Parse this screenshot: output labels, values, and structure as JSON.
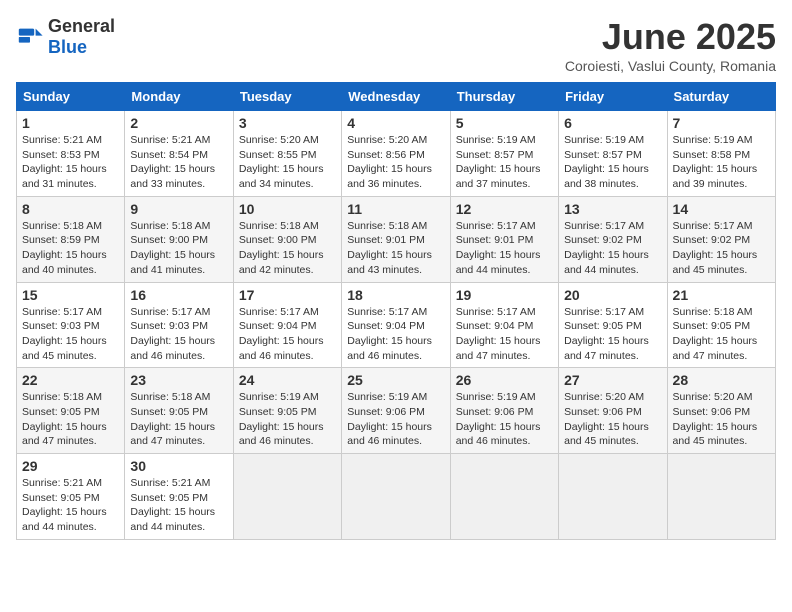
{
  "app": {
    "name_general": "General",
    "name_blue": "Blue"
  },
  "calendar": {
    "title": "June 2025",
    "subtitle": "Coroiesti, Vaslui County, Romania",
    "days_of_week": [
      "Sunday",
      "Monday",
      "Tuesday",
      "Wednesday",
      "Thursday",
      "Friday",
      "Saturday"
    ],
    "weeks": [
      [
        null,
        {
          "day": "2",
          "sunrise": "Sunrise: 5:21 AM",
          "sunset": "Sunset: 8:54 PM",
          "daylight": "Daylight: 15 hours and 33 minutes."
        },
        {
          "day": "3",
          "sunrise": "Sunrise: 5:20 AM",
          "sunset": "Sunset: 8:55 PM",
          "daylight": "Daylight: 15 hours and 34 minutes."
        },
        {
          "day": "4",
          "sunrise": "Sunrise: 5:20 AM",
          "sunset": "Sunset: 8:56 PM",
          "daylight": "Daylight: 15 hours and 36 minutes."
        },
        {
          "day": "5",
          "sunrise": "Sunrise: 5:19 AM",
          "sunset": "Sunset: 8:57 PM",
          "daylight": "Daylight: 15 hours and 37 minutes."
        },
        {
          "day": "6",
          "sunrise": "Sunrise: 5:19 AM",
          "sunset": "Sunset: 8:57 PM",
          "daylight": "Daylight: 15 hours and 38 minutes."
        },
        {
          "day": "7",
          "sunrise": "Sunrise: 5:19 AM",
          "sunset": "Sunset: 8:58 PM",
          "daylight": "Daylight: 15 hours and 39 minutes."
        }
      ],
      [
        {
          "day": "1",
          "sunrise": "Sunrise: 5:21 AM",
          "sunset": "Sunset: 8:53 PM",
          "daylight": "Daylight: 15 hours and 31 minutes."
        },
        {
          "day": "9",
          "sunrise": "Sunrise: 5:18 AM",
          "sunset": "Sunset: 9:00 PM",
          "daylight": "Daylight: 15 hours and 41 minutes."
        },
        {
          "day": "10",
          "sunrise": "Sunrise: 5:18 AM",
          "sunset": "Sunset: 9:00 PM",
          "daylight": "Daylight: 15 hours and 42 minutes."
        },
        {
          "day": "11",
          "sunrise": "Sunrise: 5:18 AM",
          "sunset": "Sunset: 9:01 PM",
          "daylight": "Daylight: 15 hours and 43 minutes."
        },
        {
          "day": "12",
          "sunrise": "Sunrise: 5:17 AM",
          "sunset": "Sunset: 9:01 PM",
          "daylight": "Daylight: 15 hours and 44 minutes."
        },
        {
          "day": "13",
          "sunrise": "Sunrise: 5:17 AM",
          "sunset": "Sunset: 9:02 PM",
          "daylight": "Daylight: 15 hours and 44 minutes."
        },
        {
          "day": "14",
          "sunrise": "Sunrise: 5:17 AM",
          "sunset": "Sunset: 9:02 PM",
          "daylight": "Daylight: 15 hours and 45 minutes."
        }
      ],
      [
        {
          "day": "8",
          "sunrise": "Sunrise: 5:18 AM",
          "sunset": "Sunset: 8:59 PM",
          "daylight": "Daylight: 15 hours and 40 minutes."
        },
        {
          "day": "16",
          "sunrise": "Sunrise: 5:17 AM",
          "sunset": "Sunset: 9:03 PM",
          "daylight": "Daylight: 15 hours and 46 minutes."
        },
        {
          "day": "17",
          "sunrise": "Sunrise: 5:17 AM",
          "sunset": "Sunset: 9:04 PM",
          "daylight": "Daylight: 15 hours and 46 minutes."
        },
        {
          "day": "18",
          "sunrise": "Sunrise: 5:17 AM",
          "sunset": "Sunset: 9:04 PM",
          "daylight": "Daylight: 15 hours and 46 minutes."
        },
        {
          "day": "19",
          "sunrise": "Sunrise: 5:17 AM",
          "sunset": "Sunset: 9:04 PM",
          "daylight": "Daylight: 15 hours and 47 minutes."
        },
        {
          "day": "20",
          "sunrise": "Sunrise: 5:17 AM",
          "sunset": "Sunset: 9:05 PM",
          "daylight": "Daylight: 15 hours and 47 minutes."
        },
        {
          "day": "21",
          "sunrise": "Sunrise: 5:18 AM",
          "sunset": "Sunset: 9:05 PM",
          "daylight": "Daylight: 15 hours and 47 minutes."
        }
      ],
      [
        {
          "day": "15",
          "sunrise": "Sunrise: 5:17 AM",
          "sunset": "Sunset: 9:03 PM",
          "daylight": "Daylight: 15 hours and 45 minutes."
        },
        {
          "day": "23",
          "sunrise": "Sunrise: 5:18 AM",
          "sunset": "Sunset: 9:05 PM",
          "daylight": "Daylight: 15 hours and 47 minutes."
        },
        {
          "day": "24",
          "sunrise": "Sunrise: 5:19 AM",
          "sunset": "Sunset: 9:05 PM",
          "daylight": "Daylight: 15 hours and 46 minutes."
        },
        {
          "day": "25",
          "sunrise": "Sunrise: 5:19 AM",
          "sunset": "Sunset: 9:06 PM",
          "daylight": "Daylight: 15 hours and 46 minutes."
        },
        {
          "day": "26",
          "sunrise": "Sunrise: 5:19 AM",
          "sunset": "Sunset: 9:06 PM",
          "daylight": "Daylight: 15 hours and 46 minutes."
        },
        {
          "day": "27",
          "sunrise": "Sunrise: 5:20 AM",
          "sunset": "Sunset: 9:06 PM",
          "daylight": "Daylight: 15 hours and 45 minutes."
        },
        {
          "day": "28",
          "sunrise": "Sunrise: 5:20 AM",
          "sunset": "Sunset: 9:06 PM",
          "daylight": "Daylight: 15 hours and 45 minutes."
        }
      ],
      [
        {
          "day": "22",
          "sunrise": "Sunrise: 5:18 AM",
          "sunset": "Sunset: 9:05 PM",
          "daylight": "Daylight: 15 hours and 47 minutes."
        },
        {
          "day": "30",
          "sunrise": "Sunrise: 5:21 AM",
          "sunset": "Sunset: 9:05 PM",
          "daylight": "Daylight: 15 hours and 44 minutes."
        },
        null,
        null,
        null,
        null,
        null
      ],
      [
        {
          "day": "29",
          "sunrise": "Sunrise: 5:21 AM",
          "sunset": "Sunset: 9:05 PM",
          "daylight": "Daylight: 15 hours and 44 minutes."
        },
        null,
        null,
        null,
        null,
        null,
        null
      ]
    ]
  }
}
